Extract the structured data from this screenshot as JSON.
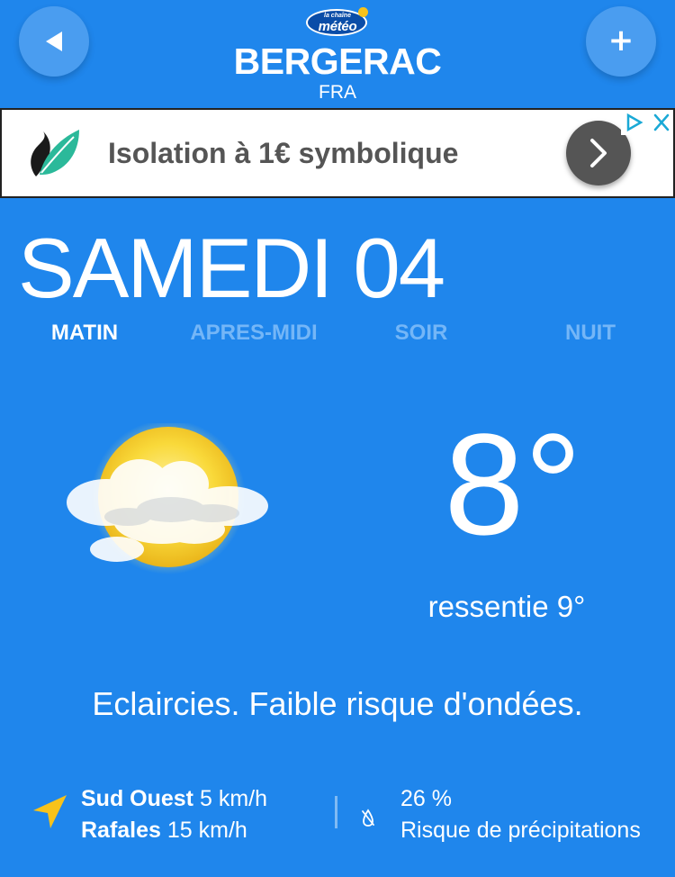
{
  "logo": {
    "small_text": "la chaîne",
    "main_text": "météo"
  },
  "header": {
    "city": "BERGERAC",
    "country": "FRA"
  },
  "ad": {
    "text": "Isolation à 1€ symbolique"
  },
  "day": "SAMEDI 04",
  "tabs": [
    {
      "label": "MATIN",
      "active": true
    },
    {
      "label": "APRES-MIDI",
      "active": false
    },
    {
      "label": "SOIR",
      "active": false
    },
    {
      "label": "NUIT",
      "active": false
    }
  ],
  "weather": {
    "icon": "sun-behind-cloud-icon",
    "temperature": "8°",
    "feels_label": "ressentie",
    "feels_value": "9°",
    "description": "Eclaircies. Faible risque d'ondées."
  },
  "wind": {
    "direction": "Sud Ouest",
    "speed": "5 km/h",
    "gust_label": "Rafales",
    "gust_speed": "15 km/h"
  },
  "precipitation": {
    "value": "26 %",
    "label": "Risque de précipitations"
  },
  "colors": {
    "background": "#1f86ec",
    "button": "#4a9df0",
    "inactive_tab": "#74b6f7",
    "wind_arrow": "#f7c21b",
    "ad_leaf": "#2bb99a"
  }
}
